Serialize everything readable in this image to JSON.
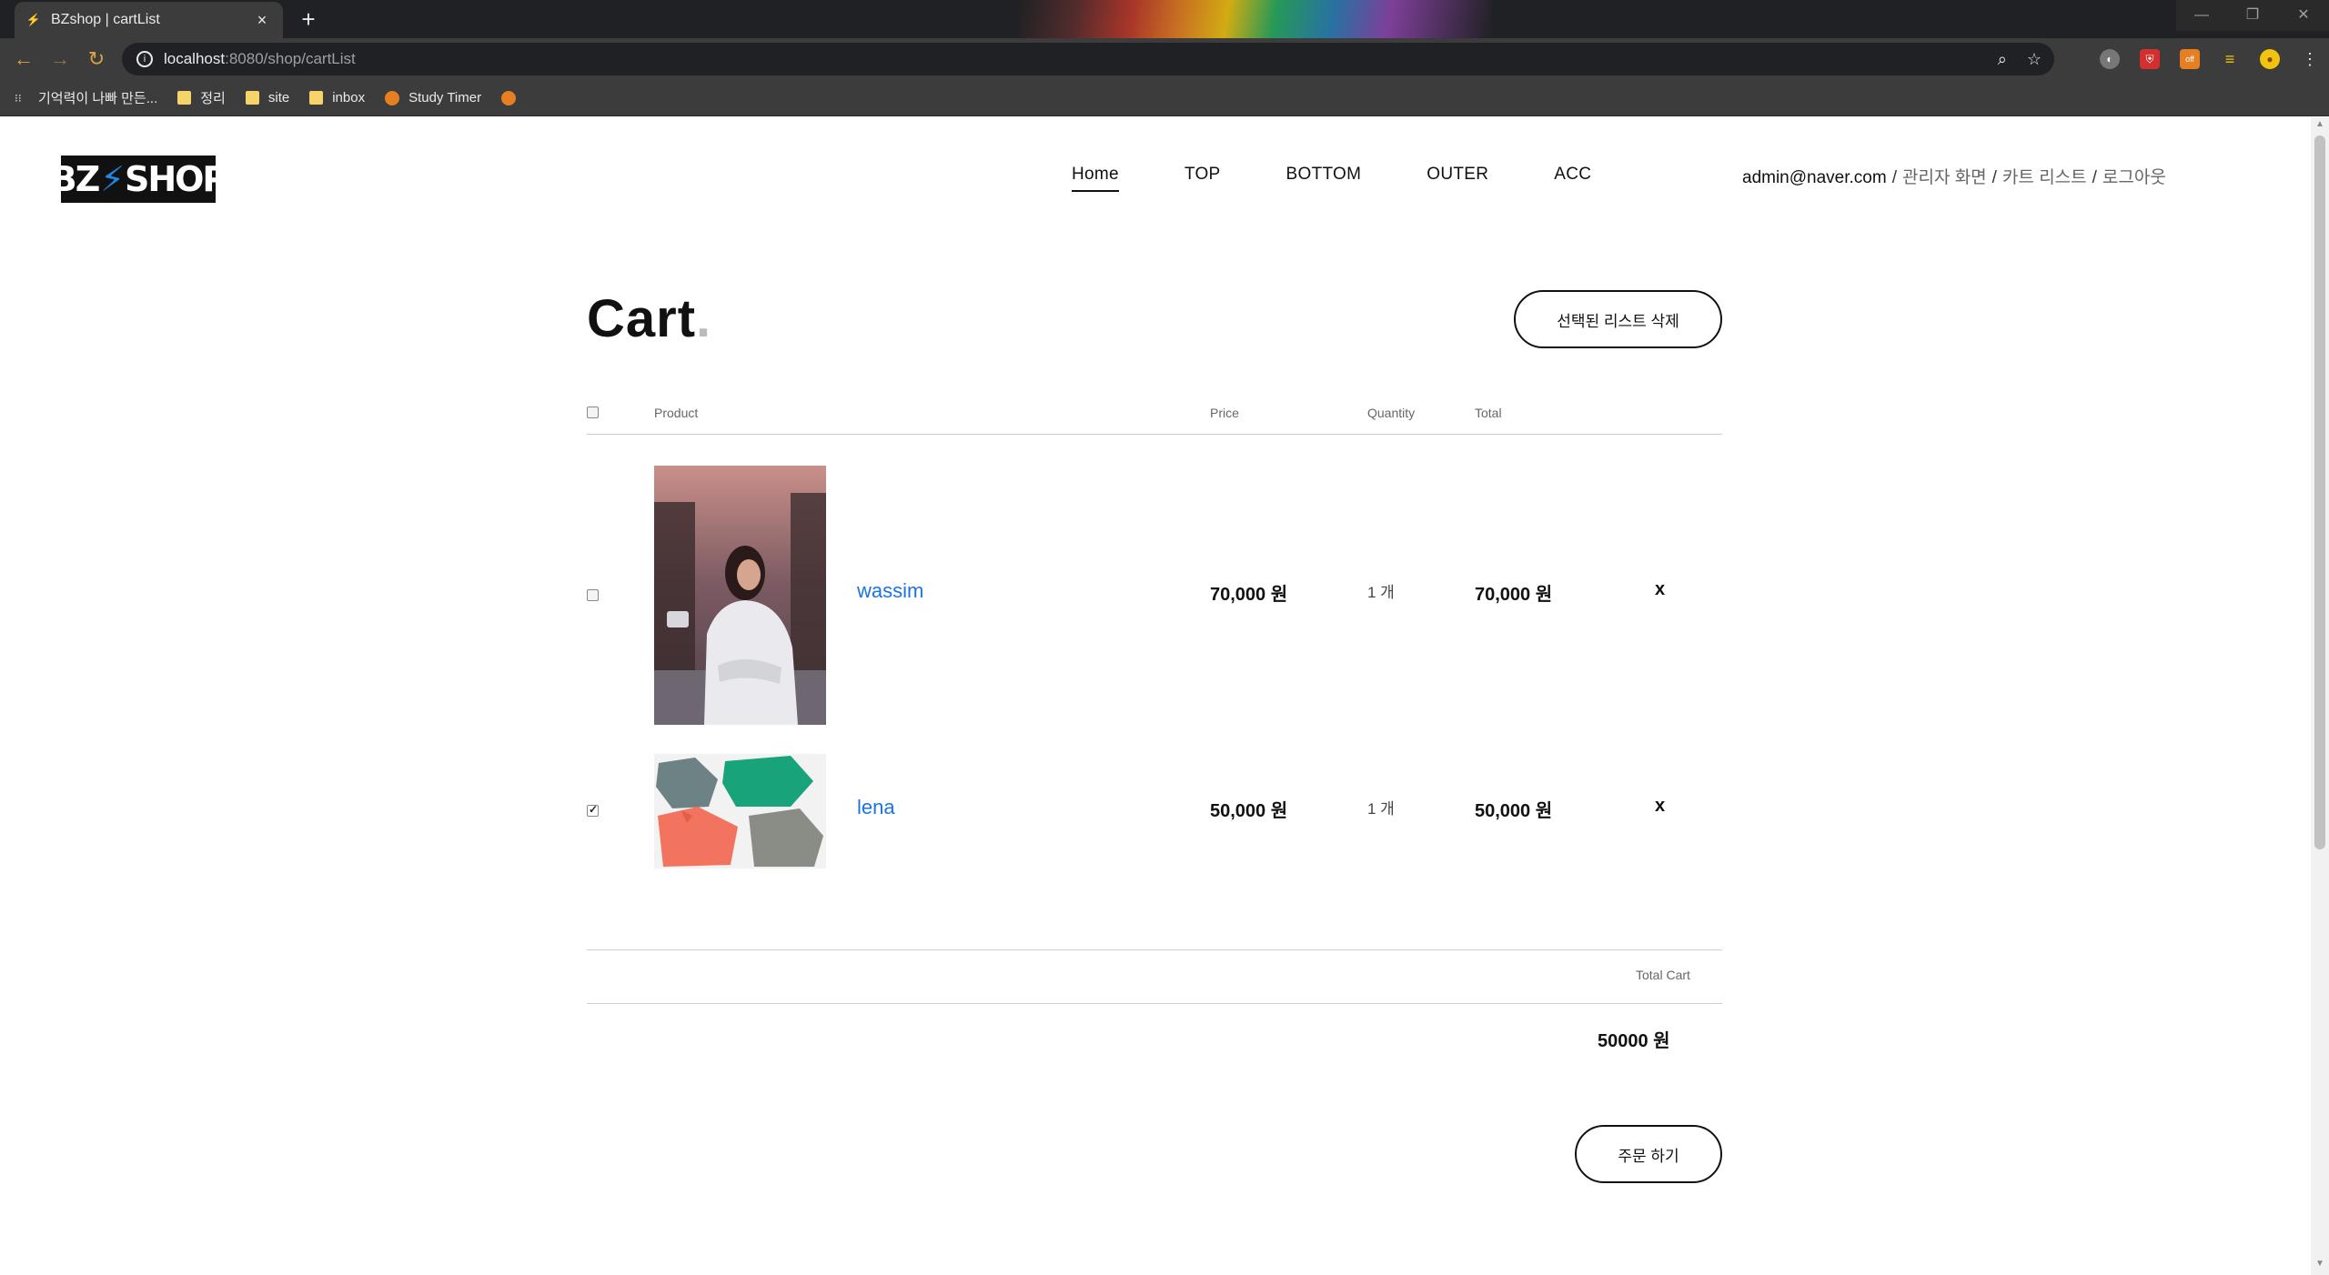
{
  "browser": {
    "tab_title": "BZshop | cartList",
    "tab_close": "×",
    "new_tab": "+",
    "url_host": "localhost",
    "url_path": ":8080/shop/cartList",
    "bookmarks": [
      {
        "label": "기억력이 나빠 만든...",
        "icon": "dots-icon"
      },
      {
        "label": "정리",
        "icon": "folder-icon"
      },
      {
        "label": "site",
        "icon": "folder-icon"
      },
      {
        "label": "inbox",
        "icon": "folder-icon"
      },
      {
        "label": "Study Timer",
        "icon": "globe-icon"
      },
      {
        "label": "",
        "icon": "globe-icon"
      }
    ],
    "extension_badge": "off"
  },
  "header": {
    "logo_left": "BZ",
    "logo_bolt": "⚡",
    "logo_right": "SHOP",
    "nav": [
      {
        "label": "Home",
        "active": true
      },
      {
        "label": "TOP"
      },
      {
        "label": "BOTTOM"
      },
      {
        "label": "OUTER"
      },
      {
        "label": "ACC"
      }
    ],
    "user_email": "admin@naver.com",
    "separator": "/",
    "admin_link": "관리자 화면",
    "cart_link": "카트 리스트",
    "logout_link": "로그아웃"
  },
  "cart": {
    "title": "Cart",
    "title_dot": ".",
    "delete_selected_label": "선택된 리스트 삭제",
    "columns": {
      "product": "Product",
      "price": "Price",
      "quantity": "Quantity",
      "total": "Total"
    },
    "items": [
      {
        "name": "wassim",
        "price": "70,000 원",
        "quantity": "1 개",
        "total": "70,000 원",
        "remove": "x",
        "checked": false,
        "image": "photo-woman-white-sweater"
      },
      {
        "name": "lena",
        "price": "50,000 원",
        "quantity": "1 개",
        "total": "50,000 원",
        "remove": "x",
        "checked": true,
        "image": "photo-folded-polo-shirts"
      }
    ],
    "total_cart_label": "Total Cart",
    "total_cart_value": "50000 원",
    "order_button_label": "주문 하기"
  },
  "colors": {
    "accent_link": "#1a73e8",
    "text": "#111111",
    "muted": "#666666"
  }
}
